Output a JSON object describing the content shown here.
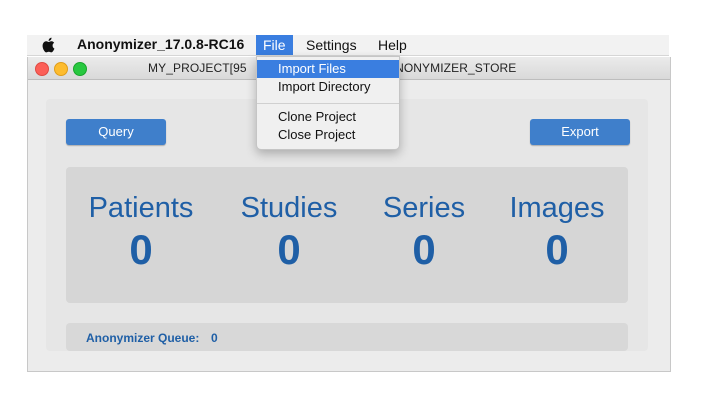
{
  "menubar": {
    "app_name": "Anonymizer_17.0.8-RC16",
    "menus": [
      "File",
      "Settings",
      "Help"
    ],
    "active_menu": "File"
  },
  "window": {
    "title": "MY_PROJECT[95",
    "title_tail": "or/ANONYMIZER_STORE"
  },
  "file_menu": {
    "items": [
      "Import Files",
      "Import Directory",
      "Clone Project",
      "Close Project"
    ],
    "selected": "Import Files"
  },
  "buttons": {
    "query": "Query",
    "export": "Export"
  },
  "stats": {
    "patients": {
      "label": "Patients",
      "value": "0"
    },
    "studies": {
      "label": "Studies",
      "value": "0"
    },
    "series": {
      "label": "Series",
      "value": "0"
    },
    "images": {
      "label": "Images",
      "value": "0"
    }
  },
  "queue": {
    "label": "Anonymizer Queue:",
    "value": "0"
  },
  "colors": {
    "accent": "#3f7fcb",
    "stat_text": "#1f5fa6",
    "menu_highlight": "#3a7ee0"
  }
}
